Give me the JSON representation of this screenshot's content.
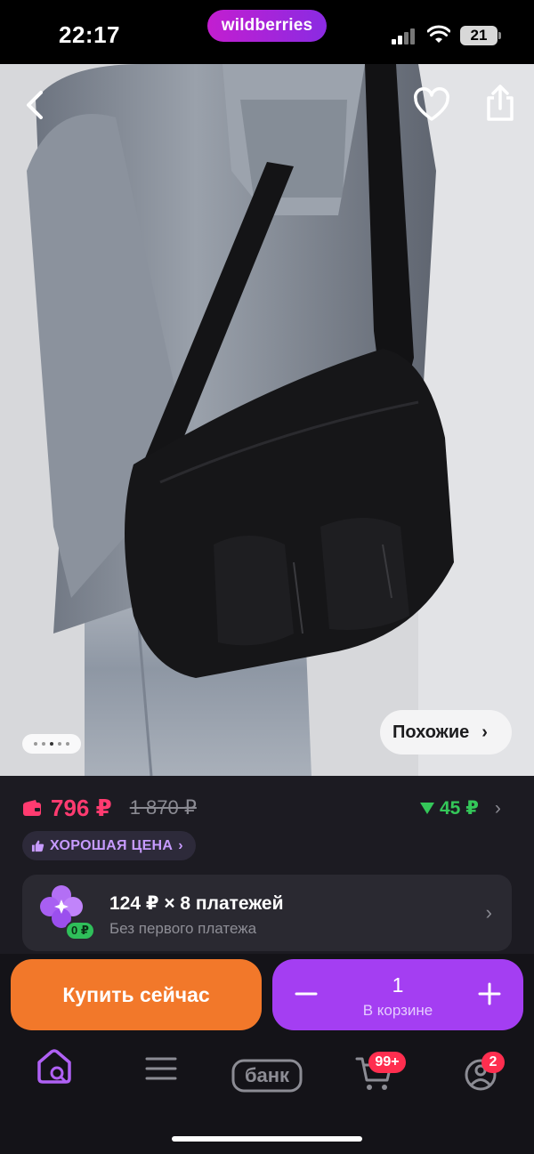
{
  "status_bar": {
    "time": "22:17",
    "brand": "wildberries",
    "battery": "21"
  },
  "gallery": {
    "similar_label": "Похожие",
    "similar_chevron": "›",
    "active_dot": 2
  },
  "price": {
    "current": "796 ₽",
    "old": "1 870 ₽",
    "bonus": "45 ₽",
    "bonus_chevron": "›"
  },
  "badge": {
    "label": "ХОРОШАЯ ЦЕНА",
    "chevron": "›"
  },
  "installment": {
    "title": "124 ₽ × 8 платежей",
    "subtitle": "Без первого платежа",
    "badge": "0 ₽",
    "chevron": "›"
  },
  "actions": {
    "buy_label": "Купить сейчас",
    "quantity": "1",
    "cart_label": "В корзине"
  },
  "tabbar": {
    "bank_label": "банк",
    "cart_badge": "99+",
    "profile_badge": "2"
  },
  "colors": {
    "accent": "#a43ef2",
    "buy": "#f2782a",
    "price": "#ff3b70",
    "bonus": "#34c759",
    "panel": "#1c1b22"
  },
  "icons": [
    "back-icon",
    "heart-icon",
    "share-icon",
    "wallet-icon",
    "thumbs-up-icon",
    "home-search-icon",
    "catalog-icon",
    "cart-icon",
    "profile-icon"
  ]
}
